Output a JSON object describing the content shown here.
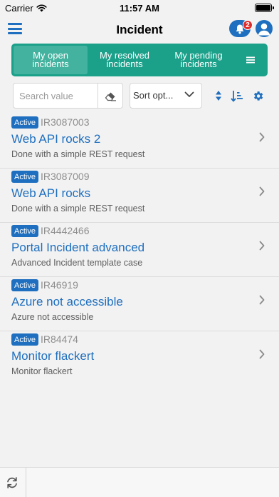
{
  "status_bar": {
    "carrier": "Carrier",
    "time": "11:57 AM"
  },
  "nav": {
    "title": "Incident",
    "notification_count": "2"
  },
  "tabs": [
    {
      "label": "My open incidents",
      "active": true
    },
    {
      "label": "My resolved incidents",
      "active": false
    },
    {
      "label": "My pending incidents",
      "active": false
    }
  ],
  "filters": {
    "search_placeholder": "Search value",
    "sort_label": "Sort opt..."
  },
  "incidents": [
    {
      "status": "Active",
      "ref": "IR3087003",
      "title": "Web API rocks 2",
      "description": "Done with a simple REST request"
    },
    {
      "status": "Active",
      "ref": "IR3087009",
      "title": "Web API rocks",
      "description": "Done with a simple REST request"
    },
    {
      "status": "Active",
      "ref": "IR4442466",
      "title": "Portal Incident advanced",
      "description": "Advanced Incident template case"
    },
    {
      "status": "Active",
      "ref": "IR46919",
      "title": "Azure not accessible",
      "description": "Azure not accessible"
    },
    {
      "status": "Active",
      "ref": "IR84474",
      "title": "Monitor flackert",
      "description": "Monitor flackert"
    }
  ],
  "colors": {
    "accent": "#1e6fbf",
    "tab_bar": "#1ba08a",
    "tab_active": "#43b29e",
    "badge_alert": "#e02b2b"
  },
  "icons": [
    "wifi-icon",
    "battery-icon",
    "hamburger-menu-icon",
    "bell-icon",
    "user-icon",
    "eraser-icon",
    "chevron-down-icon",
    "sort-arrows-icon",
    "sort-order-icon",
    "gear-icon",
    "chevron-right-icon",
    "refresh-icon"
  ]
}
